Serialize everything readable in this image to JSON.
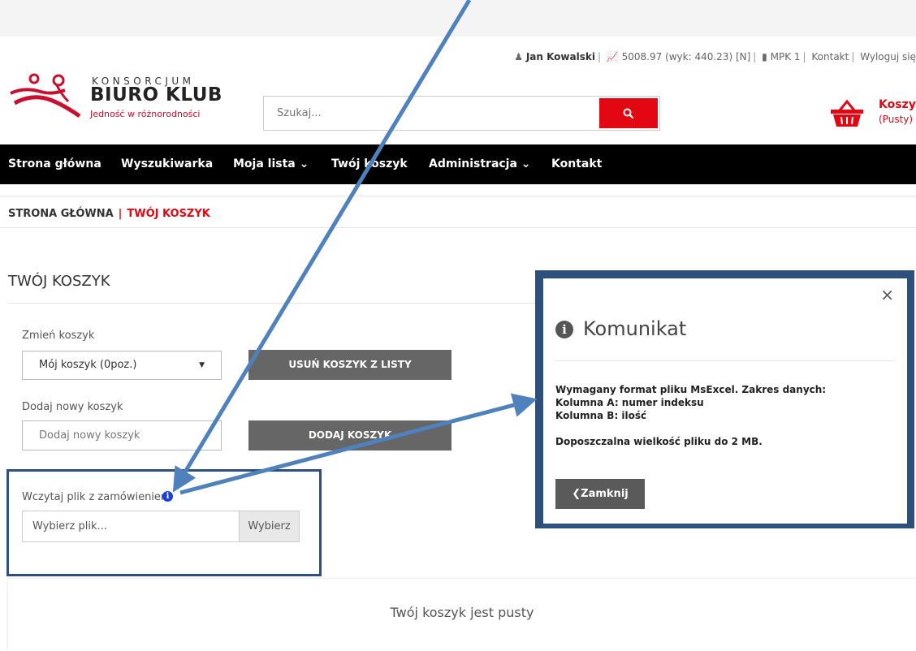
{
  "user_bar": {
    "user_name": "Jan Kowalski",
    "balance": "5008.97 (wyk: 440.23) [N]",
    "mpk": "MPK 1",
    "contact": "Kontakt",
    "logout": "Wyloguj się"
  },
  "logo": {
    "line1": "KONSORCJUM",
    "line2": "BIURO KLUB",
    "tagline": "Jedność w różnorodności"
  },
  "search": {
    "placeholder": "Szukaj..."
  },
  "cart": {
    "title": "Koszyk",
    "status": "(Pusty)"
  },
  "nav": {
    "items": [
      {
        "label": "Strona główna"
      },
      {
        "label": "Wyszukiwarka"
      },
      {
        "label": "Moja lista ⌄"
      },
      {
        "label": "Twój koszyk"
      },
      {
        "label": "Administracja ⌄"
      },
      {
        "label": "Kontakt"
      }
    ]
  },
  "breadcrumb": {
    "home": "STRONA GŁÓWNA",
    "separator": "|",
    "current": "TWÓJ KOSZYK"
  },
  "page": {
    "title": "TWÓJ KOSZYK",
    "change_cart_label": "Zmień koszyk",
    "cart_select_value": "Mój koszyk (0poz.)",
    "remove_cart_button": "USUŃ KOSZYK Z LISTY",
    "add_cart_label": "Dodaj nowy koszyk",
    "add_cart_placeholder": "Dodaj nowy koszyk",
    "add_cart_button": "DODAJ KOSZYK",
    "upload_label": "Wczytaj plik z zamówieniem",
    "upload_placeholder": "Wybierz plik...",
    "upload_button": "Wybierz",
    "empty_message": "Twój koszyk jest pusty"
  },
  "modal": {
    "title": "Komunikat",
    "close": "×",
    "line1": "Wymagany format pliku MsExcel. Zakres danych:",
    "line2": "Kolumna A: numer indeksu",
    "line3": "Kolumna B: ilość",
    "line4": "Doposzczalna wielkość pliku do 2 MB.",
    "button": "Zamknij"
  },
  "colors": {
    "brand_red": "#e30613",
    "nav_bg": "#000000",
    "annotation_blue": "#2d4f7c",
    "arrow_blue": "#4f81bd"
  },
  "icons": [
    "user-icon",
    "chart-icon",
    "book-icon",
    "search-icon",
    "basket-icon",
    "info-icon",
    "chevron-left-icon",
    "close-icon"
  ]
}
